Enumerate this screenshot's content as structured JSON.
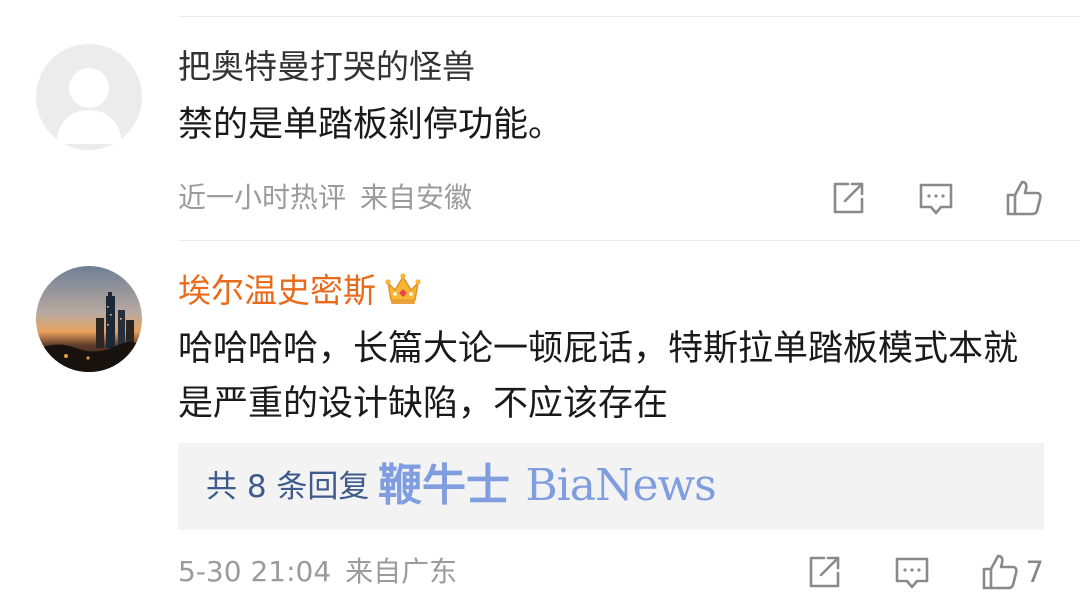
{
  "comments": [
    {
      "username": "把奥特曼打哭的怪兽",
      "username_style": "plain",
      "avatar": "default-avatar-silhouette",
      "text": "禁的是单踏板刹停功能。",
      "meta": {
        "time": "近一小时热评",
        "location": "来自安徽"
      },
      "actions": {
        "share_icon": "share-icon",
        "comment_icon": "comment-icon",
        "like_icon": "thumbs-up-icon",
        "like_count": ""
      }
    },
    {
      "username": "埃尔温史密斯",
      "username_style": "vip",
      "badge_icon": "vip-crown-icon",
      "avatar": "city-skyline-sunset-photo",
      "text": "哈哈哈哈，长篇大论一顿屁话，特斯拉单踏板模式本就是严重的设计缺陷，不应该存在",
      "reply_summary": "共 8 条回复",
      "meta": {
        "time": "5-30 21:04",
        "location": "来自广东"
      },
      "actions": {
        "share_icon": "share-icon",
        "comment_icon": "comment-icon",
        "like_icon": "thumbs-up-icon",
        "like_count": "7"
      }
    }
  ],
  "watermark": {
    "cn": "鞭牛士",
    "latin": "BiaNews"
  },
  "colors": {
    "vip_name": "#e86b1c",
    "meta_gray": "#9b9b9b",
    "reply_link": "#3f5b8c",
    "reply_bg": "#f3f3f3",
    "watermark": "#6c8fdc",
    "icon_gray": "#8a8a8a"
  }
}
